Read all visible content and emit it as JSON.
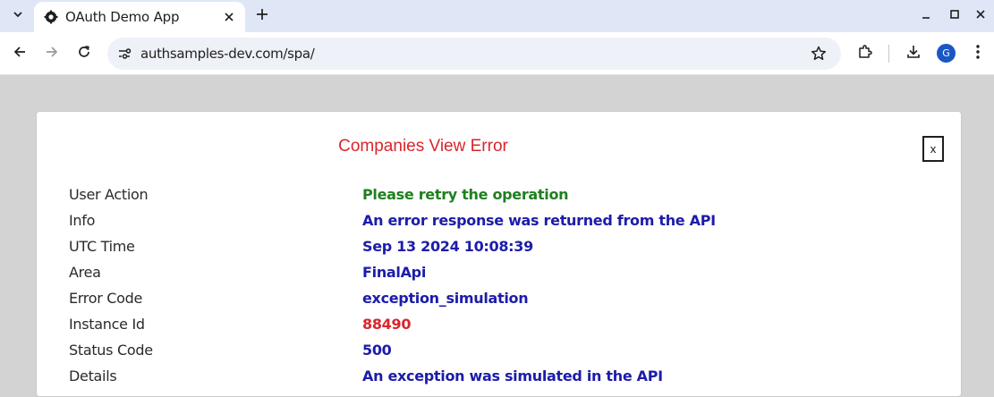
{
  "browser": {
    "tab": {
      "title": "OAuth Demo App",
      "favicon": "gear-icon"
    },
    "address_bar": {
      "url": "authsamples-dev.com/spa/"
    },
    "profile": {
      "initial": "G",
      "color": "#1a57c4"
    }
  },
  "error_card": {
    "title": "Companies View Error",
    "close_label": "x",
    "rows": [
      {
        "label": "User Action",
        "value": "Please retry the operation",
        "color": "#1f7f1f"
      },
      {
        "label": "Info",
        "value": "An error response was returned from the API",
        "color": "#1c1cab"
      },
      {
        "label": "UTC Time",
        "value": "Sep 13 2024 10:08:39",
        "color": "#1c1cab"
      },
      {
        "label": "Area",
        "value": "FinalApi",
        "color": "#1c1cab"
      },
      {
        "label": "Error Code",
        "value": "exception_simulation",
        "color": "#1c1cab"
      },
      {
        "label": "Instance Id",
        "value": "88490",
        "color": "#d8262c"
      },
      {
        "label": "Status Code",
        "value": "500",
        "color": "#1c1cab"
      },
      {
        "label": "Details",
        "value": "An exception was simulated in the API",
        "color": "#1c1cab"
      }
    ]
  }
}
